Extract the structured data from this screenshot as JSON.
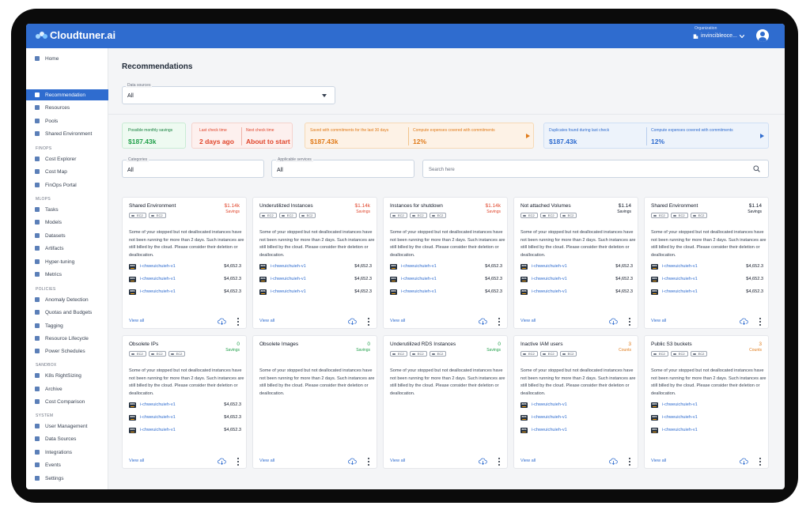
{
  "app": {
    "name": "Cloudtuner.ai",
    "organization_label": "Organization",
    "organization_value": "invincibleoce..."
  },
  "sidebar": {
    "items": [
      {
        "label": "Home",
        "icon": "home-icon"
      },
      {
        "label": "Recommendation",
        "icon": "thumbs-up-icon",
        "active": true
      },
      {
        "label": "Resources",
        "icon": "resources-icon"
      },
      {
        "label": "Pools",
        "icon": "pools-icon"
      },
      {
        "label": "Shared Environment",
        "icon": "shared-env-icon"
      }
    ],
    "finops_title": "FINOPS",
    "finops": [
      {
        "label": "Cost Explorer",
        "icon": "cost-explorer-icon"
      },
      {
        "label": "Cost Map",
        "icon": "map-pin-icon"
      },
      {
        "label": "FinOps Portal",
        "icon": "portal-icon"
      }
    ],
    "mlops_title": "MLOPS",
    "mlops": [
      {
        "label": "Tasks",
        "icon": "tasks-icon"
      },
      {
        "label": "Models",
        "icon": "models-icon"
      },
      {
        "label": "Datasets",
        "icon": "datasets-icon"
      },
      {
        "label": "Artifacts",
        "icon": "artifacts-icon"
      },
      {
        "label": "Hyper-tuning",
        "icon": "hyper-tuning-icon"
      },
      {
        "label": "Metrics",
        "icon": "metrics-icon"
      }
    ],
    "policies_title": "POLICIES",
    "policies": [
      {
        "label": "Anomaly Detection",
        "icon": "anomaly-icon"
      },
      {
        "label": "Quotas and Budgets",
        "icon": "quotas-icon"
      },
      {
        "label": "Tagging",
        "icon": "tag-icon"
      },
      {
        "label": "Resource Lifecycle",
        "icon": "lifecycle-icon"
      },
      {
        "label": "Power Schedules",
        "icon": "power-icon"
      }
    ],
    "sandbox_title": "SANDBOX",
    "sandbox": [
      {
        "label": "K8s RightSizing",
        "icon": "k8s-icon"
      },
      {
        "label": "Archive",
        "icon": "archive-icon"
      },
      {
        "label": "Cost Comparison",
        "icon": "compare-icon"
      }
    ],
    "system_title": "SYSTEM",
    "system": [
      {
        "label": "User Management",
        "icon": "users-icon"
      },
      {
        "label": "Data Sources",
        "icon": "data-sources-icon"
      },
      {
        "label": "Integrations",
        "icon": "integrations-icon"
      },
      {
        "label": "Events",
        "icon": "events-icon"
      },
      {
        "label": "Settings",
        "icon": "gear-icon"
      }
    ]
  },
  "main": {
    "title": "Recommendations",
    "data_sources_label": "Data sources",
    "data_sources_value": "All"
  },
  "summary": {
    "possible_savings_label": "Possible monthly savings",
    "possible_savings_value": "$187.43k",
    "last_check_label": "Last check time",
    "last_check_value": "2 days ago",
    "next_check_label": "Next check time",
    "next_check_value": "About to start",
    "saved_label": "Saved with commitments for the last 30 days",
    "saved_value": "$187.43k",
    "compute_covered_label": "Compute expenses covered with commitments",
    "compute_covered_value": "12%",
    "duplicates_label": "Duplicates found during last check",
    "duplicates_value": "$187.43k",
    "compute_covered2_label": "Compute expenses covered with commitments",
    "compute_covered2_value": "12%"
  },
  "filters": {
    "categories_label": "Categories",
    "categories_value": "All",
    "services_label": "Applicable services",
    "services_value": "All",
    "search_placeholder": "Search here"
  },
  "colors": {
    "brand": "#2f6ccf",
    "savings_red": "#e0452b",
    "savings_green": "#22a04b",
    "warning_orange": "#e07b1a",
    "info_blue": "#2f6ccf"
  },
  "cards": [
    {
      "title": "Shared Environment",
      "metric": "$1.14k",
      "metric_label": "Savings",
      "tone": "red",
      "chips": [
        "EC2",
        "EC2"
      ],
      "desc": "Some of your stopped but not deallocated instances have not been running for more than 2 days. Such instances are still billed by the cloud. Please consider their deletion or deallocation.",
      "instances": [
        {
          "name": "i-chweuichuieh-v1",
          "cost": "$4,652.3"
        },
        {
          "name": "i-chweuichuieh-v1",
          "cost": "$4,652.3"
        },
        {
          "name": "i-chweuichuieh-v1",
          "cost": "$4,652.3"
        }
      ],
      "view_all": "View all"
    },
    {
      "title": "Underutilized Instances",
      "metric": "$1.14k",
      "metric_label": "Savings",
      "tone": "red",
      "chips": [
        "EC2",
        "EC2",
        "EC2"
      ],
      "desc": "Some of your stopped but not deallocated instances have not been running for more than 2 days. Such instances are still billed by the cloud. Please consider their deletion or deallocation.",
      "instances": [
        {
          "name": "i-chweuichuieh-v1",
          "cost": "$4,652.3"
        },
        {
          "name": "i-chweuichuieh-v1",
          "cost": "$4,652.3"
        },
        {
          "name": "i-chweuichuieh-v1",
          "cost": "$4,652.3"
        }
      ],
      "view_all": "View all"
    },
    {
      "title": "Instances for shutdown",
      "metric": "$1.14k",
      "metric_label": "Savings",
      "tone": "red",
      "chips": [
        "EC2",
        "EC2",
        "EC2"
      ],
      "desc": "Some of your stopped but not deallocated instances have not been running for more than 2 days. Such instances are still billed by the cloud. Please consider their deletion or deallocation.",
      "instances": [
        {
          "name": "i-chweuichuieh-v1",
          "cost": "$4,652.3"
        },
        {
          "name": "i-chweuichuieh-v1",
          "cost": "$4,652.3"
        },
        {
          "name": "i-chweuichuieh-v1",
          "cost": "$4,652.3"
        }
      ],
      "view_all": "View all"
    },
    {
      "title": "Not attached Volumes",
      "metric": "$1.14",
      "metric_label": "Savings",
      "tone": "dark",
      "chips": [
        "EC2",
        "EC2",
        "EC2"
      ],
      "desc": "Some of your stopped but not deallocated instances have not been running for more than 2 days. Such instances are still billed by the cloud. Please consider their deletion or deallocation.",
      "instances": [
        {
          "name": "i-chweuichuieh-v1",
          "cost": "$4,652.3"
        },
        {
          "name": "i-chweuichuieh-v1",
          "cost": "$4,652.3"
        },
        {
          "name": "i-chweuichuieh-v1",
          "cost": "$4,652.3"
        }
      ],
      "view_all": "View all"
    },
    {
      "title": "Shared Environment",
      "metric": "$1.14",
      "metric_label": "Savings",
      "tone": "dark",
      "chips": [
        "EC2",
        "EC2",
        "EC2"
      ],
      "desc": "Some of your stopped but not deallocated instances have not been running for more than 2 days. Such instances are still billed by the cloud. Please consider their deletion or deallocation.",
      "instances": [
        {
          "name": "i-chweuichuieh-v1",
          "cost": "$4,652.3"
        },
        {
          "name": "i-chweuichuieh-v1",
          "cost": "$4,652.3"
        },
        {
          "name": "i-chweuichuieh-v1",
          "cost": "$4,652.3"
        }
      ],
      "view_all": "View all"
    },
    {
      "title": "Obsolete IPs",
      "metric": "0",
      "metric_label": "Savings",
      "tone": "green",
      "chips": [
        "EC2",
        "EC2",
        "EC2"
      ],
      "desc": "Some of your stopped but not deallocated instances have not been running for more than 2 days. Such instances are still billed by the cloud. Please consider their deletion or deallocation.",
      "instances": [
        {
          "name": "i-chweuichuieh-v1",
          "cost": "$4,652.3"
        },
        {
          "name": "i-chweuichuieh-v1",
          "cost": "$4,652.3"
        },
        {
          "name": "i-chweuichuieh-v1",
          "cost": "$4,652.3"
        }
      ],
      "view_all": "View all"
    },
    {
      "title": "Obsolete Images",
      "metric": "0",
      "metric_label": "Savings",
      "tone": "green",
      "chips": [],
      "desc": "Some of your stopped but not deallocated instances have not been running for more than 2 days. Such instances are still billed by the cloud. Please consider their deletion or deallocation.",
      "instances": [],
      "view_all": "View all"
    },
    {
      "title": "Underutilized RDS Instances",
      "metric": "0",
      "metric_label": "Savings",
      "tone": "green",
      "chips": [
        "EC2",
        "EC2",
        "EC2"
      ],
      "desc": "Some of your stopped but not deallocated instances have not been running for more than 2 days. Such instances are still billed by the cloud. Please consider their deletion or deallocation.",
      "instances": [],
      "view_all": "View all"
    },
    {
      "title": "Inactive IAM users",
      "metric": "3",
      "metric_label": "Counts",
      "tone": "orange",
      "chips": [
        "EC2",
        "EC2",
        "EC2"
      ],
      "desc": "Some of your stopped but not deallocated instances have not been running for more than 2 days. Such instances are still billed by the cloud. Please consider their deletion or deallocation.",
      "instances": [
        {
          "name": "i-chweuichuieh-v1",
          "cost": ""
        },
        {
          "name": "i-chweuichuieh-v1",
          "cost": ""
        },
        {
          "name": "i-chweuichuieh-v1",
          "cost": ""
        }
      ],
      "view_all": "View all"
    },
    {
      "title": "Public S3 buckets",
      "metric": "3",
      "metric_label": "Counts",
      "tone": "orange",
      "chips": [
        "EC2",
        "EC2",
        "EC2"
      ],
      "desc": "Some of your stopped but not deallocated instances have not been running for more than 2 days. Such instances are still billed by the cloud. Please consider their deletion or deallocation.",
      "instances": [
        {
          "name": "i-chweuichuieh-v1",
          "cost": ""
        },
        {
          "name": "i-chweuichuieh-v1",
          "cost": ""
        },
        {
          "name": "i-chweuichuieh-v1",
          "cost": ""
        }
      ],
      "view_all": "View all"
    }
  ]
}
